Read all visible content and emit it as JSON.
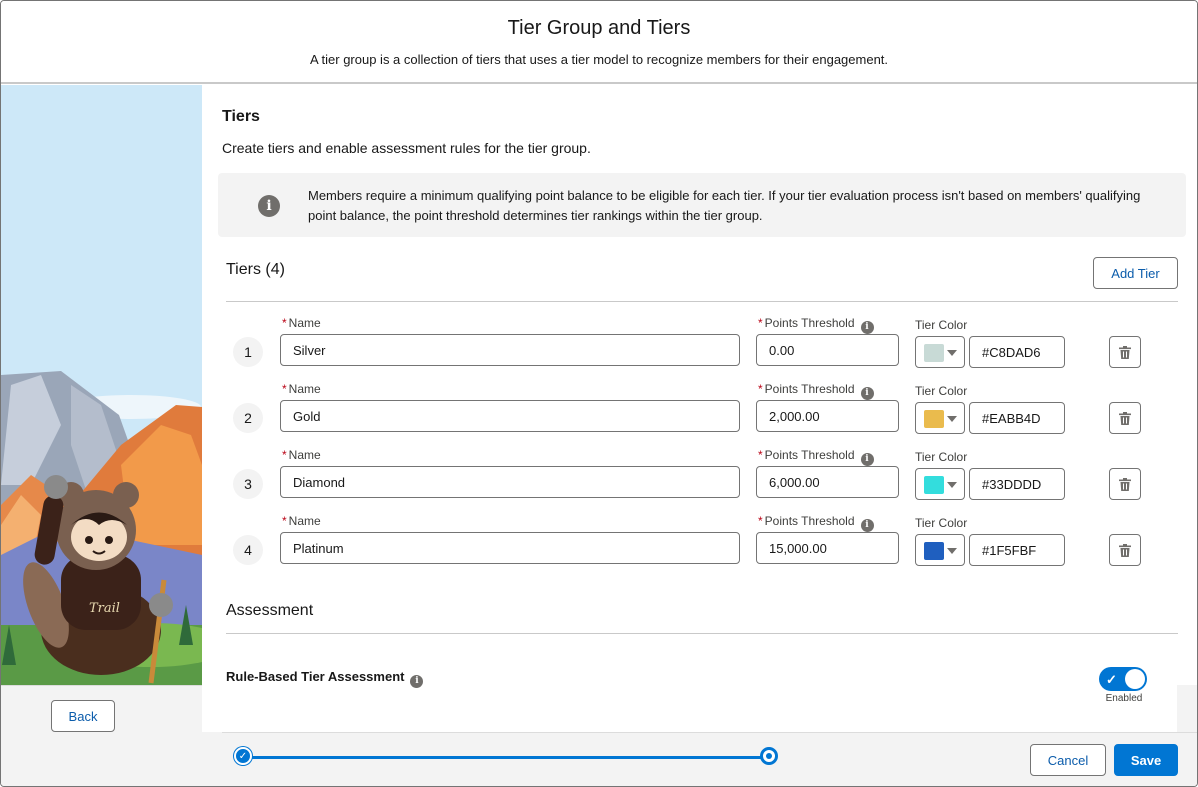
{
  "header": {
    "title": "Tier Group and Tiers",
    "subtitle": "A tier group is a collection of tiers that uses a tier model to recognize members for their engagement."
  },
  "tiers_section": {
    "title": "Tiers",
    "description": "Create tiers and enable assessment rules for the tier group.",
    "info_text": "Members require a minimum qualifying point balance to be eligible for each tier. If your tier evaluation process isn't based on members' qualifying point balance, the point threshold determines tier rankings within the tier group.",
    "list_title": "Tiers (4)",
    "add_tier_label": "Add Tier",
    "name_label": "Name",
    "points_label": "Points Threshold",
    "color_label": "Tier Color",
    "required_marker": "*"
  },
  "tiers": [
    {
      "num": "1",
      "name": "Silver",
      "points": "0.00",
      "color_hex": "#C8DAD6",
      "swatch": "#C8DAD6"
    },
    {
      "num": "2",
      "name": "Gold",
      "points": "2,000.00",
      "color_hex": "#EABB4D",
      "swatch": "#EABB4D"
    },
    {
      "num": "3",
      "name": "Diamond",
      "points": "6,000.00",
      "color_hex": "#33DDDD",
      "swatch": "#33DDDD"
    },
    {
      "num": "4",
      "name": "Platinum",
      "points": "15,000.00",
      "color_hex": "#1F5FBF",
      "swatch": "#1F5FBF"
    }
  ],
  "assessment": {
    "title": "Assessment",
    "rule_label": "Rule-Based Tier Assessment",
    "toggle_state": "Enabled"
  },
  "footer": {
    "back_label": "Back",
    "cancel_label": "Cancel",
    "save_label": "Save"
  },
  "icons": {
    "info": "i",
    "check": "✓"
  },
  "colors": {
    "brand": "#0176d3",
    "required": "#ba0517"
  }
}
